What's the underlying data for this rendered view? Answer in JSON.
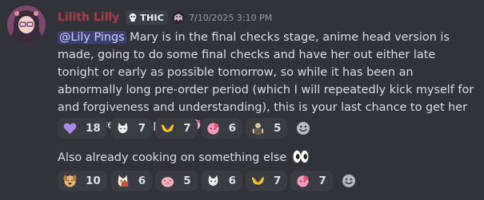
{
  "message": {
    "username": "Lilith Lilly",
    "server_tag": "THIC",
    "timestamp": "7/10/2025 3:10 PM",
    "mention": "@Lily Pings",
    "text": " Mary is in the final checks stage, anime head version is made, going to do some final checks and have her out either late tonight or early as possible tomorrow, so while it has been an abnormally long pre-order period (which I will repeatedly kick myself for and forgiveness and understanding), this is your last chance to get her at the pre-order price",
    "trailing_emoji": "pink-bow-character-emoji",
    "reactions": [
      {
        "icon": "purple-heart-icon",
        "count": "18"
      },
      {
        "icon": "white-cat-emoji",
        "count": "7"
      },
      {
        "icon": "heart-hands-emoji",
        "count": "7"
      },
      {
        "icon": "pink-character-emoji",
        "count": "6"
      },
      {
        "icon": "figure-emoji",
        "count": "5"
      }
    ]
  },
  "followup": {
    "text": "Also already cooking on something else",
    "trailing_emoji": "eyes-emoji",
    "reactions": [
      {
        "icon": "dog-face-emoji",
        "count": "10"
      },
      {
        "icon": "cat-character-emoji",
        "count": "6"
      },
      {
        "icon": "pink-pig-emoji",
        "count": "5"
      },
      {
        "icon": "white-cat-emoji",
        "count": "6"
      },
      {
        "icon": "heart-hands-emoji",
        "count": "7"
      },
      {
        "icon": "pink-character-emoji",
        "count": "7"
      }
    ]
  },
  "colors": {
    "background": "#323339",
    "username": "#c0404a",
    "mention_text": "#c9cdfb",
    "reaction_bg": "#3b3c42",
    "timestamp": "#949ba4"
  }
}
